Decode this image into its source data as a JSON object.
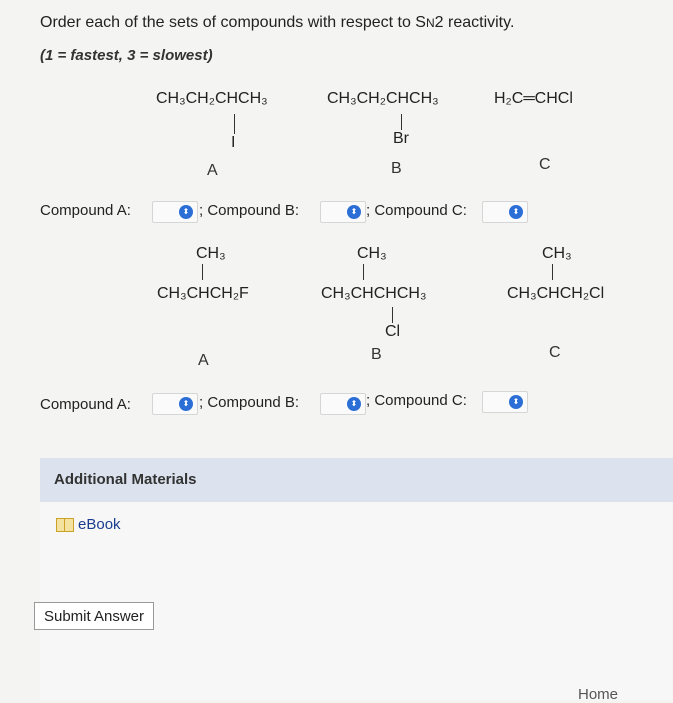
{
  "question": {
    "title_pre": "Order each of the sets of compounds with respect to S",
    "title_sub": "N",
    "title_post": "2 reactivity.",
    "subtitle": "(1 = fastest, 3 = slowest)"
  },
  "set1": {
    "compound_a": {
      "main": "CH₃CH₂CHCH₃",
      "sub": "I",
      "letter": "A"
    },
    "compound_b": {
      "main": "CH₃CH₂CHCH₃",
      "sub": "Br",
      "letter": "B"
    },
    "compound_c": {
      "main": "H₂C═CHCl",
      "letter": "C"
    },
    "label_a": "Compound A:",
    "label_b": "; Compound B:",
    "label_c": "; Compound C:"
  },
  "set2": {
    "compound_a": {
      "top": "CH₃",
      "main": "CH₃CHCH₂F",
      "letter": "A"
    },
    "compound_b": {
      "top": "CH₃",
      "main": "CH₃CHCHCH₃",
      "sub": "Cl",
      "letter": "B"
    },
    "compound_c": {
      "top": "CH₃",
      "main": "CH₃CHCH₂Cl",
      "letter": "C"
    },
    "label_a": "Compound A:",
    "label_b": "; Compound B:",
    "label_c": "; Compound C:"
  },
  "additional": {
    "title": "Additional Materials",
    "ebook": "eBook"
  },
  "submit_label": "Submit Answer",
  "footer": {
    "home": "Home"
  },
  "colors": {
    "accent": "#2b6fd6",
    "panel_header": "#dce3ee",
    "link": "#1a3c8f"
  }
}
